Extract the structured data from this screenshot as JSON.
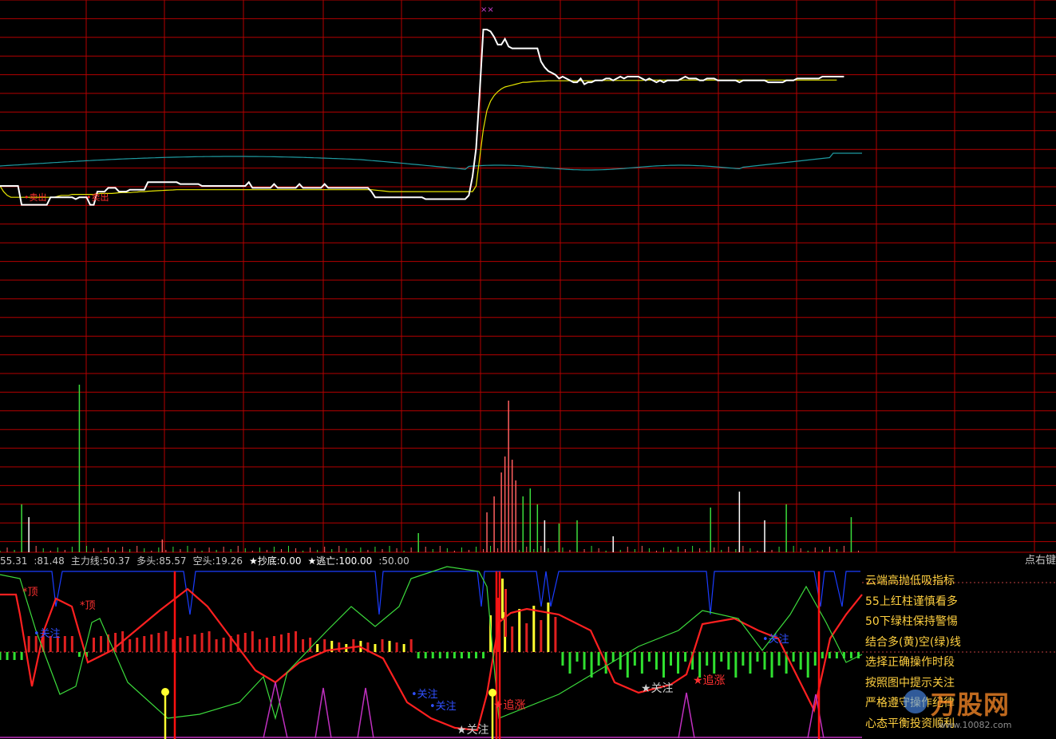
{
  "header": {
    "legend": [
      {
        "label": "",
        "value": "55.31",
        "color": "#c8c8c8"
      },
      {
        "label": "",
        "value": ":81.48",
        "color": "#c8c8c8"
      },
      {
        "label": "主力线",
        "value": ":50.37",
        "color": "#c8c8c8"
      },
      {
        "label": "多头",
        "value": ":85.57",
        "color": "#c8c8c8"
      },
      {
        "label": "空头",
        "value": ":19.26",
        "color": "#c8c8c8"
      },
      {
        "label": "★抄底",
        "value": ":0.00",
        "color": "#ffffff"
      },
      {
        "label": "★逃亡",
        "value": ":100.00",
        "color": "#ffffff"
      },
      {
        "label": "",
        "value": ":50.00",
        "color": "#c8c8c8"
      }
    ],
    "hint": "点右键"
  },
  "notes": [
    "云端高抛低吸指标",
    "55上红柱谨慎看多",
    "50下绿柱保持警惕",
    "结合多(黄)空(绿)线",
    "选择正确操作时段",
    "按照图中提示关注",
    "严格遵守操作纪律",
    "心态平衡投资顺利"
  ],
  "annotations": {
    "top_mark_1": "*顶",
    "top_mark_2": "*顶",
    "watch": "关注",
    "watch_star": "★关注",
    "chase_star": "★追涨",
    "price_labels": [
      "•卖出",
      "•卖出"
    ],
    "cross_marks": "××"
  },
  "watermark": {
    "brand": "万股网",
    "url": "www.10082.com"
  },
  "colors": {
    "background": "#000000",
    "grid": "#b40000",
    "price_line": "#ffffff",
    "avg_line": "#e6e600",
    "cyan_line": "#1e9aa0",
    "main_red": "#ff2020",
    "green_line": "#3cdc3c",
    "blue_line": "#1a3cff",
    "magenta": "#c030c0",
    "bar_red": "#e02020",
    "bar_yellow": "#ffff30",
    "bar_green": "#30e030"
  },
  "chart_data": {
    "type": "line",
    "note_series": "intraday price, average price, volume and indicator oscillator",
    "x_count": 240,
    "price": [
      0,
      0,
      0,
      0,
      0,
      0,
      -1,
      -1,
      -1,
      -1,
      -1,
      -1,
      -1,
      -1,
      -0.6,
      -0.6,
      -0.6,
      -0.6,
      -0.6,
      -0.6,
      -0.6,
      -0.7,
      -0.6,
      -0.6,
      -0.6,
      -1,
      -1,
      -0.3,
      -0.3,
      -0.3,
      -0.1,
      -0.1,
      -0.1,
      -0.3,
      -0.3,
      -0.3,
      -0.2,
      -0.2,
      -0.2,
      -0.2,
      -0.2,
      0.2,
      0.2,
      0.2,
      0.2,
      0.2,
      0.2,
      0.2,
      0.2,
      0.2,
      0.1,
      0.1,
      0.1,
      0.1,
      0.1,
      0.1,
      0,
      0,
      0,
      0,
      0,
      0,
      0,
      0,
      0,
      0,
      0,
      0,
      0,
      0.2,
      -0.1,
      -0.1,
      -0.1,
      -0.1,
      -0.1,
      -0.1,
      0.1,
      -0.1,
      -0.1,
      -0.1,
      -0.1,
      -0.1,
      -0.1,
      0.1,
      -0.1,
      -0.1,
      -0.1,
      -0.1,
      -0.1,
      -0.1,
      0.1,
      -0.1,
      -0.1,
      -0.1,
      -0.1,
      -0.1,
      -0.1,
      -0.1,
      -0.1,
      -0.1,
      -0.1,
      -0.1,
      -0.1,
      -0.3,
      -0.6,
      -0.6,
      -0.6,
      -0.6,
      -0.6,
      -0.6,
      -0.6,
      -0.6,
      -0.6,
      -0.6,
      -0.6,
      -0.6,
      -0.6,
      -0.6,
      -0.7,
      -0.7,
      -0.7,
      -0.7,
      -0.7,
      -0.7,
      -0.7,
      -0.7,
      -0.7,
      -0.7,
      -0.7,
      -0.7,
      -0.5,
      0.5,
      2,
      5,
      8.3,
      8.3,
      8.2,
      7.9,
      7.5,
      7.5,
      7.8,
      7.4,
      7.3,
      7.3,
      7.3,
      7.3,
      7.3,
      7.3,
      7.3,
      7.3,
      6.6,
      6.3,
      6.1,
      6,
      5.9,
      5.7,
      5.8,
      5.7,
      5.6,
      5.5,
      5.5,
      5.7,
      5.4,
      5.5,
      5.5,
      5.6,
      5.6,
      5.6,
      5.7,
      5.7,
      5.6,
      5.7,
      5.8,
      5.7,
      5.8,
      5.8,
      5.8,
      5.8,
      5.7,
      5.6,
      5.7,
      5.6,
      5.5,
      5.6,
      5.5,
      5.6,
      5.6,
      5.6,
      5.6,
      5.7,
      5.8,
      5.7,
      5.7,
      5.7,
      5.6,
      5.6,
      5.7,
      5.7,
      5.7,
      5.6,
      5.6,
      5.6,
      5.6,
      5.6,
      5.6,
      5.5,
      5.6,
      5.6,
      5.6,
      5.6,
      5.6,
      5.6,
      5.6,
      5.5,
      5.5,
      5.5,
      5.5,
      5.5,
      5.6,
      5.6,
      5.6,
      5.7,
      5.7,
      5.7,
      5.7,
      5.7,
      5.7,
      5.7,
      5.8,
      5.8,
      5.8,
      5.8,
      5.8,
      5.8,
      5.8
    ],
    "avg": [
      0,
      -0.3,
      -0.5,
      -0.6,
      -0.6,
      -0.6,
      -0.6,
      -0.6,
      -0.6,
      -0.6,
      -0.6,
      -0.6,
      -0.6,
      -0.6,
      -0.6,
      -0.6,
      -0.55,
      -0.5,
      -0.5,
      -0.5,
      -0.45,
      -0.45,
      -0.45,
      -0.45,
      -0.45,
      -0.45,
      -0.45,
      -0.42,
      -0.4,
      -0.4,
      -0.4,
      -0.4,
      -0.38,
      -0.36,
      -0.35,
      -0.35,
      -0.35,
      -0.33,
      -0.32,
      -0.3,
      -0.3,
      -0.28,
      -0.27,
      -0.26,
      -0.25,
      -0.24,
      -0.23,
      -0.22,
      -0.21,
      -0.2,
      -0.2,
      -0.2,
      -0.2,
      -0.2,
      -0.2,
      -0.2,
      -0.2,
      -0.2,
      -0.2,
      -0.2,
      -0.2,
      -0.2,
      -0.2,
      -0.2,
      -0.2,
      -0.2,
      -0.2,
      -0.2,
      -0.2,
      -0.2,
      -0.2,
      -0.2,
      -0.2,
      -0.2,
      -0.2,
      -0.2,
      -0.2,
      -0.2,
      -0.2,
      -0.2,
      -0.2,
      -0.2,
      -0.2,
      -0.2,
      -0.2,
      -0.2,
      -0.2,
      -0.2,
      -0.2,
      -0.2,
      -0.2,
      -0.2,
      -0.2,
      -0.2,
      -0.2,
      -0.2,
      -0.2,
      -0.2,
      -0.2,
      -0.2,
      -0.2,
      -0.2,
      -0.2,
      -0.2,
      -0.22,
      -0.24,
      -0.26,
      -0.28,
      -0.3,
      -0.3,
      -0.3,
      -0.3,
      -0.3,
      -0.3,
      -0.3,
      -0.3,
      -0.3,
      -0.3,
      -0.3,
      -0.3,
      -0.3,
      -0.3,
      -0.3,
      -0.3,
      -0.3,
      -0.3,
      -0.3,
      -0.3,
      -0.3,
      -0.3,
      -0.3,
      -0.3,
      0,
      1.5,
      3,
      4,
      4.5,
      4.8,
      5,
      5.15,
      5.25,
      5.3,
      5.35,
      5.4,
      5.45,
      5.5,
      5.5,
      5.52,
      5.54,
      5.55,
      5.56,
      5.57,
      5.58,
      5.58,
      5.58,
      5.58,
      5.58,
      5.58,
      5.58,
      5.58,
      5.58,
      5.58,
      5.58,
      5.58,
      5.58,
      5.58,
      5.6,
      5.6,
      5.6,
      5.6,
      5.6,
      5.6,
      5.6,
      5.6,
      5.6,
      5.6,
      5.6,
      5.6,
      5.6,
      5.62,
      5.62,
      5.62,
      5.62,
      5.62,
      5.62,
      5.62,
      5.62,
      5.62,
      5.62,
      5.62,
      5.62,
      5.62,
      5.62,
      5.62,
      5.62,
      5.62,
      5.62,
      5.62,
      5.62,
      5.62,
      5.62,
      5.62,
      5.62,
      5.62,
      5.62,
      5.62,
      5.62,
      5.62,
      5.62,
      5.62,
      5.62,
      5.62,
      5.62,
      5.62,
      5.62,
      5.62,
      5.62,
      5.62,
      5.62,
      5.62,
      5.62,
      5.62,
      5.62,
      5.62,
      5.62,
      5.62,
      5.62,
      5.62,
      5.62,
      5.62,
      5.62,
      5.62,
      5.62
    ],
    "volume_spikes": [
      {
        "i": 6,
        "v": 30,
        "c": "g"
      },
      {
        "i": 8,
        "v": 22,
        "c": "w"
      },
      {
        "i": 22,
        "v": 105,
        "c": "g"
      },
      {
        "i": 45,
        "v": 8,
        "c": "r"
      },
      {
        "i": 116,
        "v": 12,
        "c": "g"
      },
      {
        "i": 135,
        "v": 25,
        "c": "r"
      },
      {
        "i": 137,
        "v": 35,
        "c": "r"
      },
      {
        "i": 139,
        "v": 50,
        "c": "r"
      },
      {
        "i": 140,
        "v": 60,
        "c": "r"
      },
      {
        "i": 141,
        "v": 95,
        "c": "r"
      },
      {
        "i": 142,
        "v": 58,
        "c": "r"
      },
      {
        "i": 143,
        "v": 45,
        "c": "r"
      },
      {
        "i": 145,
        "v": 35,
        "c": "g"
      },
      {
        "i": 147,
        "v": 40,
        "c": "g"
      },
      {
        "i": 149,
        "v": 30,
        "c": "g"
      },
      {
        "i": 151,
        "v": 20,
        "c": "w"
      },
      {
        "i": 155,
        "v": 18,
        "c": "g"
      },
      {
        "i": 160,
        "v": 20,
        "c": "g"
      },
      {
        "i": 170,
        "v": 10,
        "c": "w"
      },
      {
        "i": 197,
        "v": 28,
        "c": "g"
      },
      {
        "i": 205,
        "v": 38,
        "c": "w"
      },
      {
        "i": 212,
        "v": 20,
        "c": "w"
      },
      {
        "i": 218,
        "v": 30,
        "c": "g"
      },
      {
        "i": 236,
        "v": 22,
        "c": "g"
      }
    ]
  }
}
